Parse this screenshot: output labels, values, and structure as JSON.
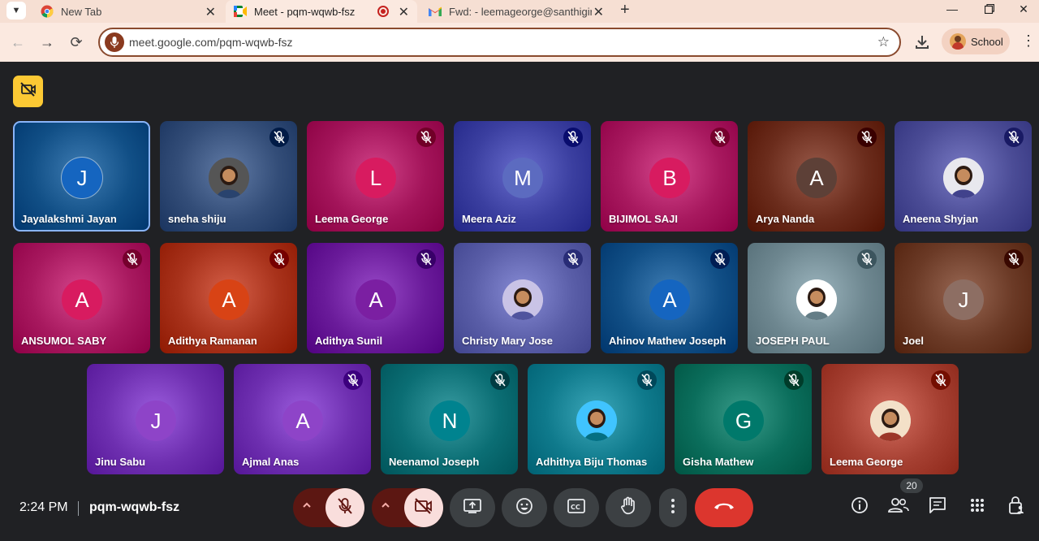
{
  "browser": {
    "tabs": [
      {
        "title": "New Tab",
        "icon": "chrome-icon",
        "active": false
      },
      {
        "title": "Meet - pqm-wqwb-fsz",
        "icon": "meet-icon",
        "active": true
      },
      {
        "title": "Fwd: - leemageorge@santhigiri",
        "icon": "gmail-icon",
        "active": false
      }
    ],
    "url": "meet.google.com/pqm-wqwb-fsz",
    "profile_label": "School"
  },
  "meeting": {
    "time": "2:24 PM",
    "code": "pqm-wqwb-fsz",
    "participant_count": "20",
    "participants": [
      {
        "name": "Jayalakshmi Jayan",
        "initial": "J",
        "tile_color": "#114f86",
        "avatar_color": "#1565c0",
        "muted": false,
        "speaking": true,
        "photo": false
      },
      {
        "name": "sneha shiju",
        "initial": "",
        "tile_color": "#334d78",
        "avatar_color": "#555555",
        "muted": true,
        "speaking": false,
        "photo": true
      },
      {
        "name": "Leema George",
        "initial": "L",
        "tile_color": "#a3145a",
        "avatar_color": "#d81b60",
        "muted": true,
        "speaking": false,
        "photo": false
      },
      {
        "name": "Meera Aziz",
        "initial": "M",
        "tile_color": "#3b3fa0",
        "avatar_color": "#5c6bc0",
        "muted": true,
        "speaking": false,
        "photo": false
      },
      {
        "name": "BIJIMOL SAJI",
        "initial": "B",
        "tile_color": "#a8195f",
        "avatar_color": "#d81b60",
        "muted": true,
        "speaking": false,
        "photo": false
      },
      {
        "name": "Arya Nanda",
        "initial": "A",
        "tile_color": "#6b2c1c",
        "avatar_color": "#5d4037",
        "muted": true,
        "speaking": false,
        "photo": false
      },
      {
        "name": "Aneena Shyjan",
        "initial": "",
        "tile_color": "#4b4c96",
        "avatar_color": "#e8e8ee",
        "muted": true,
        "speaking": false,
        "photo": true
      },
      {
        "name": "ANSUMOL SABY",
        "initial": "A",
        "tile_color": "#a8195f",
        "avatar_color": "#d81b60",
        "muted": true,
        "speaking": false,
        "photo": false
      },
      {
        "name": "Adithya Ramanan",
        "initial": "A",
        "tile_color": "#a8321b",
        "avatar_color": "#d84315",
        "muted": true,
        "speaking": false,
        "photo": false
      },
      {
        "name": "Adithya Sunil",
        "initial": "A",
        "tile_color": "#6a1b9a",
        "avatar_color": "#7b1fa2",
        "muted": true,
        "speaking": false,
        "photo": false
      },
      {
        "name": "Christy Mary Jose",
        "initial": "",
        "tile_color": "#5a5ea8",
        "avatar_color": "#c9c3e6",
        "muted": true,
        "speaking": false,
        "photo": true
      },
      {
        "name": "Ahinov Mathew Joseph",
        "initial": "A",
        "tile_color": "#114f86",
        "avatar_color": "#1565c0",
        "muted": true,
        "speaking": false,
        "photo": false
      },
      {
        "name": "JOSEPH PAUL",
        "initial": "",
        "tile_color": "#6e8790",
        "avatar_color": "#ffffff",
        "muted": true,
        "speaking": false,
        "photo": true
      },
      {
        "name": "Joel",
        "initial": "J",
        "tile_color": "#6b3a26",
        "avatar_color": "#8d6e63",
        "muted": true,
        "speaking": false,
        "photo": false
      },
      {
        "name": "Jinu Sabu",
        "initial": "J",
        "tile_color": "#6e2fb0",
        "avatar_color": "#8e44c8",
        "muted": false,
        "speaking": false,
        "photo": false
      },
      {
        "name": "Ajmal Anas",
        "initial": "A",
        "tile_color": "#6e2fb0",
        "avatar_color": "#8e44c8",
        "muted": true,
        "speaking": false,
        "photo": false
      },
      {
        "name": "Neenamol Joseph",
        "initial": "N",
        "tile_color": "#0b6e74",
        "avatar_color": "#00838f",
        "muted": true,
        "speaking": false,
        "photo": false
      },
      {
        "name": "Adhithya Biju Thomas",
        "initial": "",
        "tile_color": "#0f7a8c",
        "avatar_color": "#40c4ff",
        "muted": true,
        "speaking": false,
        "photo": true
      },
      {
        "name": "Gisha Mathew",
        "initial": "G",
        "tile_color": "#0b6e5c",
        "avatar_color": "#00796b",
        "muted": true,
        "speaking": false,
        "photo": false
      },
      {
        "name": "Leema George",
        "initial": "",
        "tile_color": "#a64032",
        "avatar_color": "#f3e0c8",
        "muted": true,
        "speaking": false,
        "photo": true
      }
    ]
  },
  "controls": [
    {
      "icon": "mic-off-icon"
    },
    {
      "icon": "camera-off-icon"
    },
    {
      "icon": "present-screen-icon"
    },
    {
      "icon": "emoji-icon"
    },
    {
      "icon": "captions-icon"
    },
    {
      "icon": "raise-hand-icon"
    },
    {
      "icon": "more-options-icon"
    },
    {
      "icon": "end-call-icon"
    }
  ],
  "colors": {
    "accent": "#8ab4f8",
    "end_call": "#dc362e",
    "badge": "#fcc934",
    "background": "#202124"
  }
}
